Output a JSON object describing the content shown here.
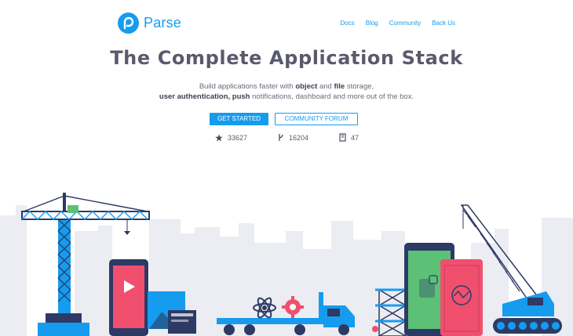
{
  "brand": {
    "name": "Parse"
  },
  "nav": {
    "items": [
      "Docs",
      "Blog",
      "Community",
      "Back Us"
    ]
  },
  "hero": {
    "headline": "The Complete Application Stack",
    "tagline": {
      "line1_prefix": "Build applications faster with ",
      "line1_bold1": "object",
      "line1_mid": " and ",
      "line1_bold2": "file",
      "line1_suffix": " storage,",
      "line2_bold": "user authentication, push",
      "line2_suffix": " notifications, dashboard and more out of the box."
    },
    "cta_primary": "GET STARTED",
    "cta_secondary": "COMMUNITY FORUM"
  },
  "stats": [
    {
      "icon": "star-icon",
      "value": "33627"
    },
    {
      "icon": "fork-icon",
      "value": "16204"
    },
    {
      "icon": "repo-icon",
      "value": "47"
    }
  ],
  "colors": {
    "accent": "#169cee",
    "navy": "#2d3a66",
    "red": "#f0506e",
    "green": "#5cc177",
    "skyline": "#ecedf2"
  }
}
